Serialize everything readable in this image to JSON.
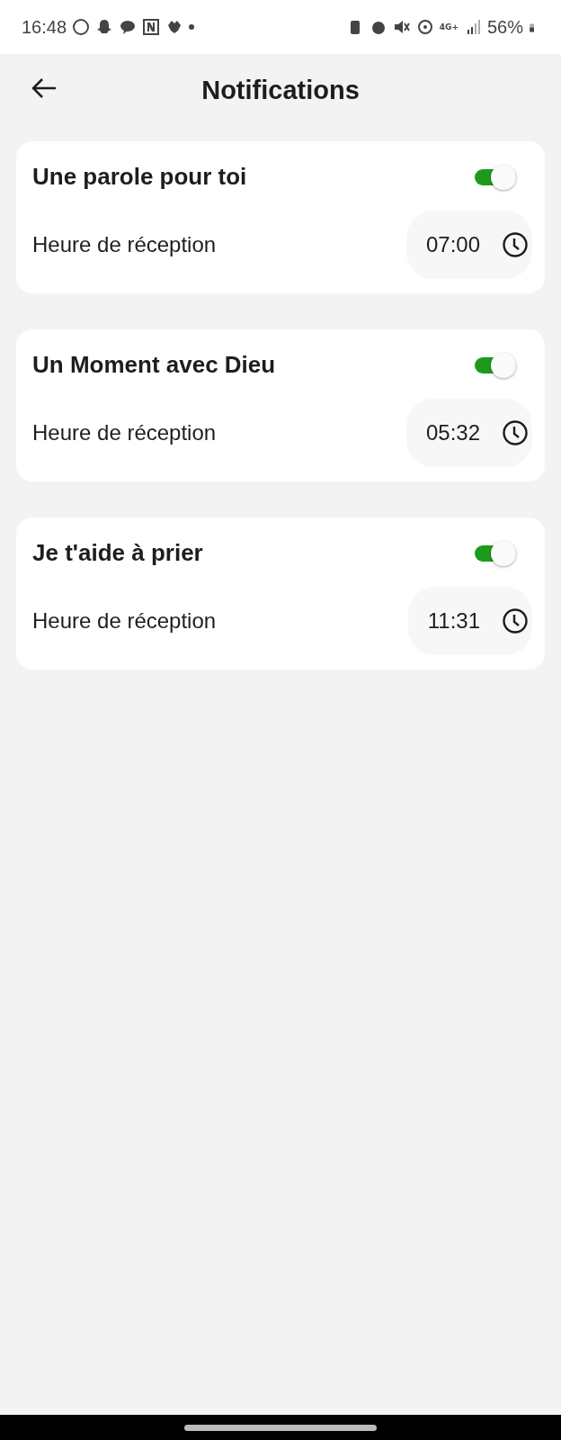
{
  "status_bar": {
    "time": "16:48",
    "network": "4G+",
    "battery": "56%"
  },
  "header": {
    "title": "Notifications"
  },
  "cards": [
    {
      "title": "Une parole pour toi",
      "on": true,
      "label": "Heure de réception",
      "time": "07:00"
    },
    {
      "title": "Un Moment avec Dieu",
      "on": true,
      "label": "Heure de réception",
      "time": "05:32"
    },
    {
      "title": "Je t'aide à prier",
      "on": true,
      "label": "Heure de réception",
      "time": "11:31"
    }
  ]
}
